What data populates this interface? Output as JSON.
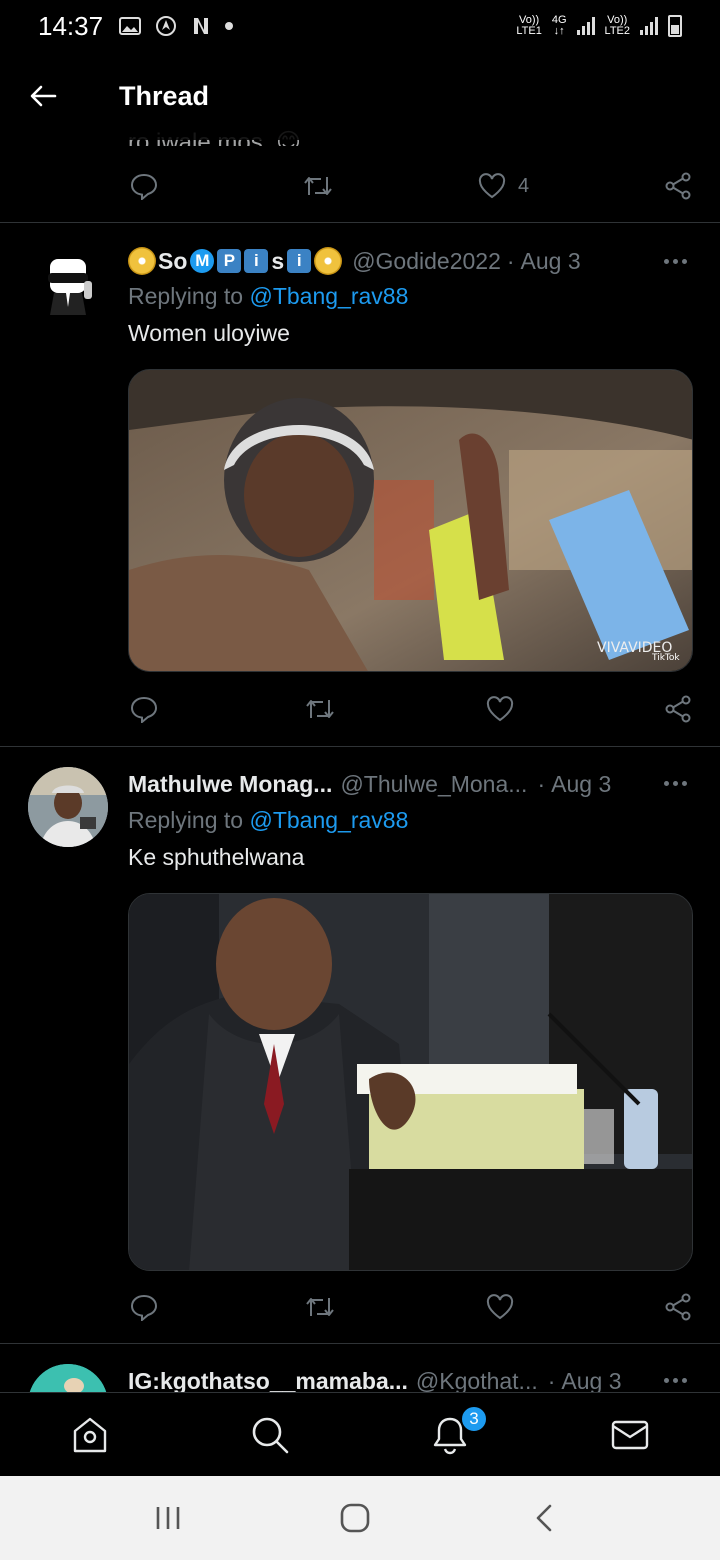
{
  "status_bar": {
    "time": "14:37",
    "icons": [
      "gallery-icon",
      "location-icon",
      "netflix-icon",
      "dot-icon"
    ],
    "sim1": {
      "top": "Vo))",
      "mid": "LTE1",
      "net": "4G"
    },
    "sim2": {
      "top": "Vo))",
      "mid": "LTE2"
    }
  },
  "header": {
    "title": "Thread",
    "partial_text": "ro jwale mos. 😊"
  },
  "top_actions": {
    "like_count": "4"
  },
  "tweets": [
    {
      "display_name_parts": [
        "So",
        "M",
        "P",
        "i",
        "s",
        "i"
      ],
      "handle": "@Godide2022",
      "dot": "·",
      "date": "Aug 3",
      "replying_prefix": "Replying to",
      "replying_to": "@Tbang_rav88",
      "text": "Women uloyiwe",
      "media_watermark": "VIVAVIDEO",
      "media_brand": "TikTok"
    },
    {
      "display_name": "Mathulwe Monag...",
      "handle": "@Thulwe_Mona...",
      "dot": "·",
      "date": "Aug 3",
      "replying_prefix": "Replying to",
      "replying_to": "@Tbang_rav88",
      "text": "Ke sphuthelwana"
    },
    {
      "display_name": "IG:kgothatso__mamaba...",
      "handle": "@Kgothat...",
      "dot": "·",
      "date": "Aug 3"
    }
  ],
  "tabbar": {
    "items": [
      "home-icon",
      "search-icon",
      "notifications-icon",
      "messages-icon"
    ],
    "notification_badge": "3"
  },
  "colors": {
    "background": "#000000",
    "accent": "#1d9bf0",
    "muted": "#6e767d",
    "text": "#e7e9ea",
    "divider": "#2f3336"
  }
}
